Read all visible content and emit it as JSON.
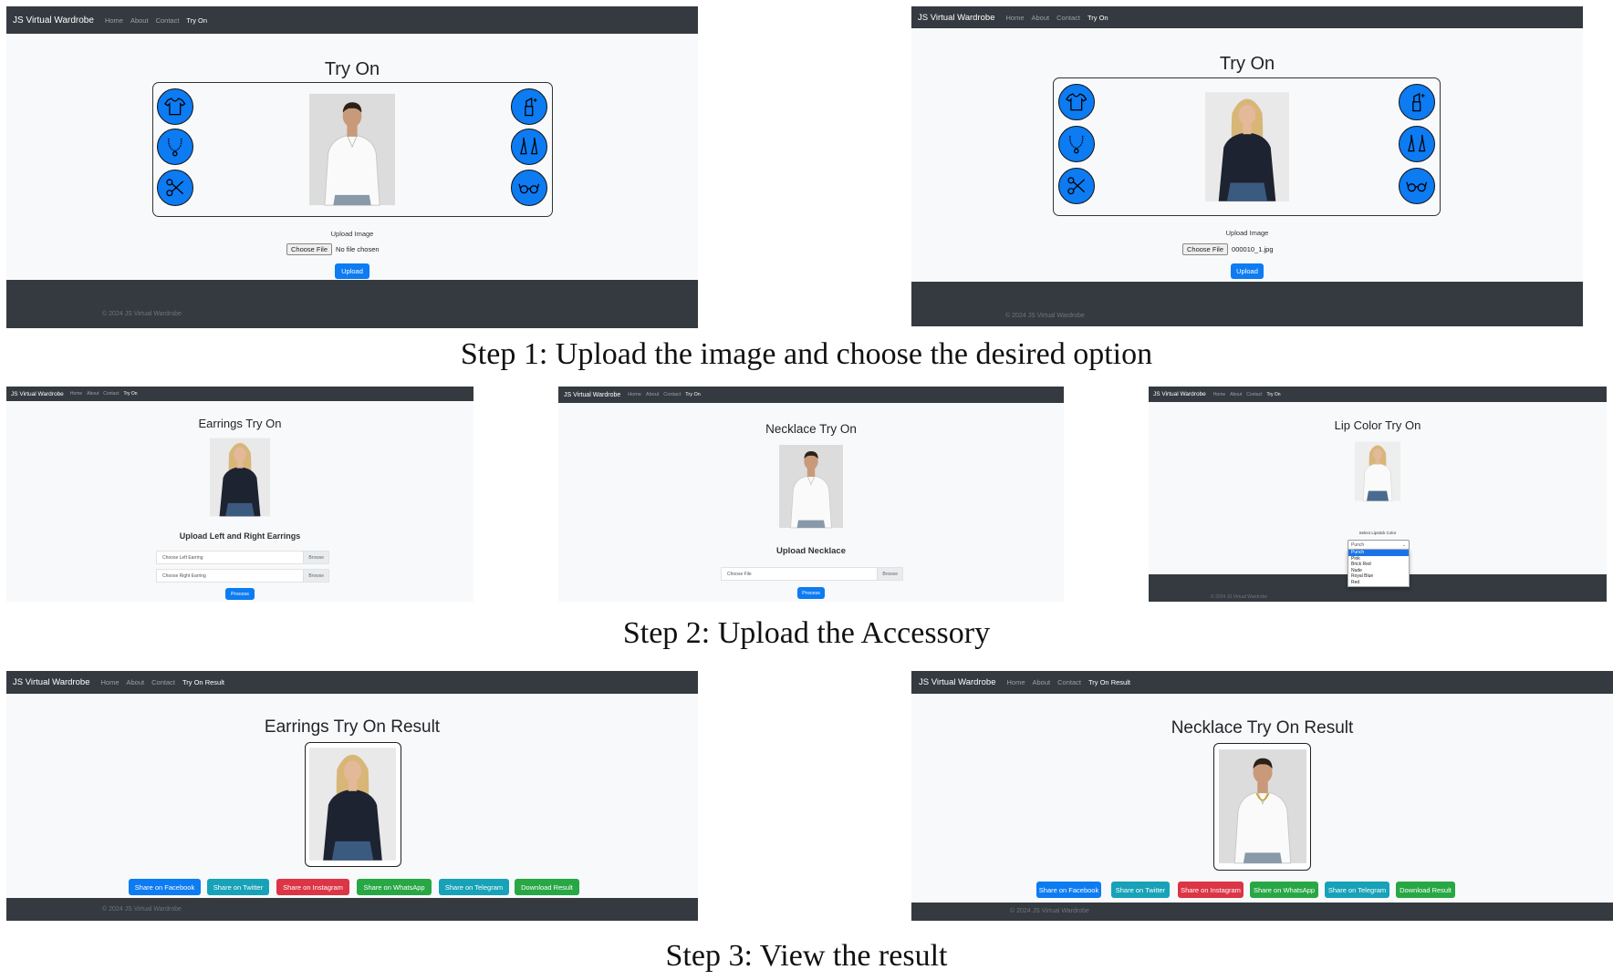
{
  "nav": {
    "brand": "JS Virtual Wardrobe",
    "home": "Home",
    "about": "About",
    "contact": "Contact",
    "try_on": "Try On",
    "try_on_result": "Try On Result"
  },
  "footer": {
    "copyright": "© 2024 JS Virtual Wardrobe"
  },
  "captions": {
    "step1": "Step 1: Upload the image and choose the desired option",
    "step2": "Step 2: Upload the Accessory",
    "step3": "Step 3: View the result"
  },
  "step1": {
    "title": "Try On",
    "icons_left": [
      "tshirt-icon",
      "necklace-icon",
      "scissors-icon"
    ],
    "icons_right": [
      "lipstick-icon",
      "earrings-icon",
      "glasses-icon"
    ],
    "upload_label": "Upload Image",
    "choose_file": "Choose File",
    "left_file_status": "No file chosen",
    "right_file_status": "000010_1.jpg",
    "upload_button": "Upload"
  },
  "step2": {
    "earrings": {
      "title": "Earrings Try On",
      "heading": "Upload Left and Right Earrings",
      "left_placeholder": "Choose Left Earring",
      "right_placeholder": "Choose Right Earring",
      "browse": "Browse",
      "process": "Process"
    },
    "necklace": {
      "title": "Necklace Try On",
      "heading": "Upload Necklace",
      "placeholder": "Choose File",
      "browse": "Browse",
      "process": "Process"
    },
    "lip": {
      "title": "Lip Color Try On",
      "select_label": "Select Lipstick Color",
      "selected": "Punch",
      "options": [
        "Punch",
        "Pink",
        "Brick Red",
        "Nude",
        "Royal Blue",
        "Red"
      ]
    }
  },
  "step3": {
    "earrings_title": "Earrings Try On Result",
    "necklace_title": "Necklace Try On Result",
    "buttons": {
      "facebook": "Share on Facebook",
      "twitter": "Share on Twitter",
      "instagram": "Share on Instagram",
      "whatsapp": "Share on WhatsApp",
      "telegram": "Share on Telegram",
      "download": "Download Result"
    }
  },
  "colors": {
    "navbar": "#343a40",
    "primary": "#0d7bf2",
    "info": "#17a2b8",
    "danger": "#dc3545",
    "success": "#28a745"
  }
}
